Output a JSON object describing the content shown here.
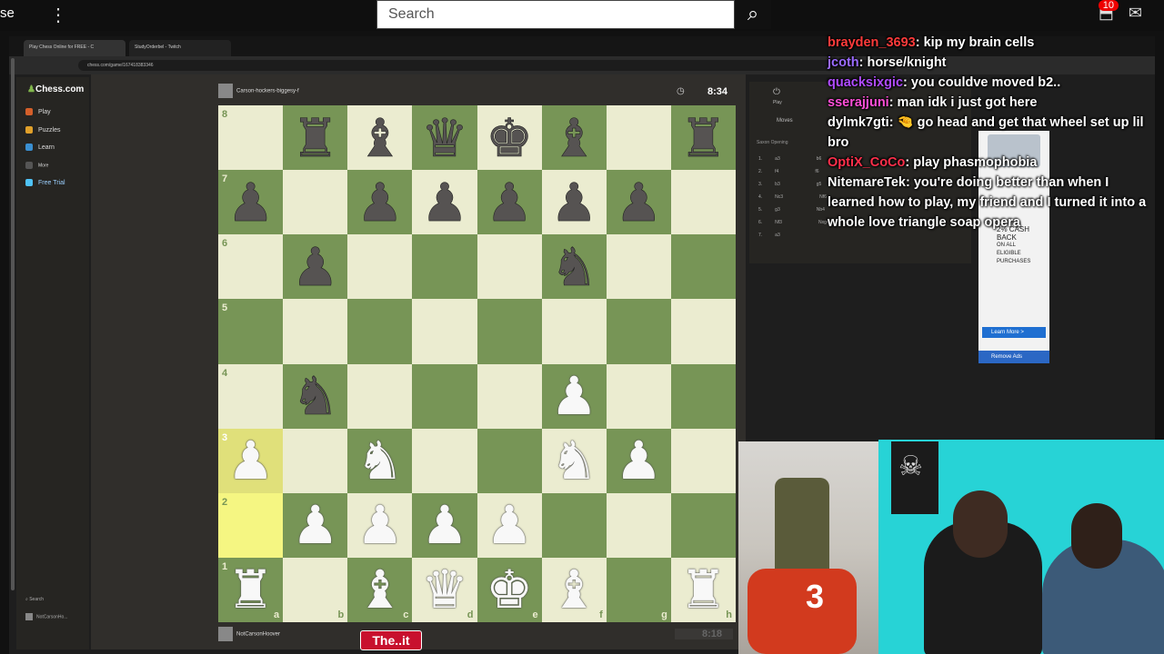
{
  "youtube": {
    "brand_text": "se",
    "search_placeholder": "Search",
    "notification_count": "10"
  },
  "browser": {
    "tab1_title": "Play Chess Online for FREE - C",
    "tab2_title": "StudyOrderbel - Twitch",
    "url": "chess.com/game/167418383346"
  },
  "sidebar": {
    "logo": "Chess.com",
    "items": [
      {
        "label": "Play"
      },
      {
        "label": "Puzzles"
      },
      {
        "label": "Learn"
      },
      {
        "label": "More"
      },
      {
        "label": "Free Trial"
      }
    ],
    "search_label": "Search",
    "user_label": "NotCarsonHo..."
  },
  "game": {
    "top_player": "Carson-hockers-biggesy-f",
    "top_clock": "8:34",
    "bottom_player": "NotCarsonHoover",
    "bottom_clock": "8:18",
    "board": [
      [
        "",
        "r",
        "b",
        "q",
        "k",
        "b",
        "",
        "r"
      ],
      [
        "p",
        "",
        "p",
        "p",
        "p",
        "p",
        "p",
        ""
      ],
      [
        "",
        "p",
        "",
        "",
        "",
        "n",
        "",
        ""
      ],
      [
        "",
        "",
        "",
        "",
        "",
        "",
        "",
        ""
      ],
      [
        "",
        "n",
        "",
        "",
        "",
        "P",
        "",
        ""
      ],
      [
        "P",
        "",
        "N",
        "",
        "",
        "N",
        "P",
        ""
      ],
      [
        "",
        "P",
        "P",
        "P",
        "P",
        "",
        "",
        ""
      ],
      [
        "R",
        "",
        "B",
        "Q",
        "K",
        "B",
        "",
        "R"
      ]
    ],
    "highlight_squares": [
      "a3",
      "a2"
    ],
    "ranks": [
      "8",
      "7",
      "6",
      "5",
      "4",
      "3",
      "2",
      "1"
    ],
    "files": [
      "a",
      "b",
      "c",
      "d",
      "e",
      "f",
      "g",
      "h"
    ]
  },
  "moves_panel": {
    "tab_play": "Play",
    "tab_moves": "Moves",
    "opening": "Saxon Opening",
    "moves": [
      {
        "n": "1.",
        "w": "a3",
        "b": "b6"
      },
      {
        "n": "2.",
        "w": "f4",
        "b": "f6"
      },
      {
        "n": "3.",
        "w": "b3",
        "b": "g5"
      },
      {
        "n": "4.",
        "w": "Nc3",
        "b": "Nf6"
      },
      {
        "n": "5.",
        "w": "g3",
        "b": "Nb4"
      },
      {
        "n": "6.",
        "w": "Nf3",
        "b": "Nxg4"
      },
      {
        "n": "7.",
        "w": "a3",
        "b": ""
      }
    ]
  },
  "ad": {
    "line1": "2% CASH",
    "line2": "BACK",
    "line3": "ON ALL",
    "line4": "ELIGIBLE",
    "line5": "PURCHASES",
    "learn_more": "Learn More >",
    "remove_ads": "Remove Ads"
  },
  "chat": [
    {
      "user": "brayden_3693",
      "user_color": "#ff3b3b",
      "text": ": kip my brain cells"
    },
    {
      "user": "jcoth",
      "user_color": "#9b6bff",
      "text": ": horse/knight"
    },
    {
      "user": "quacksixgic",
      "user_color": "#b04bff",
      "text": ": you couldve moved b2.."
    },
    {
      "user": "sserajjuni",
      "user_color": "#ff4fd8",
      "text": ": man idk i just got here"
    },
    {
      "user": "dylmk7gti",
      "user_color": "#ffffff",
      "text": ": 🤏 go head and get that wheel set up lil bro"
    },
    {
      "user": "OptiX_CoCo",
      "user_color": "#ff2f4b",
      "text": ": play phasmophobia"
    },
    {
      "user": "NitemareTek",
      "user_color": "#ffffff",
      "text": ": you're doing better than when I learned how to play, my friend and I turned it into a whole love triangle soap opera"
    }
  ],
  "bottom_logo": "The..it",
  "colors": {
    "board_light": "#ebecd0",
    "board_dark": "#779556",
    "highlight": "#f5f682",
    "chesscom_bg": "#302e2b"
  }
}
